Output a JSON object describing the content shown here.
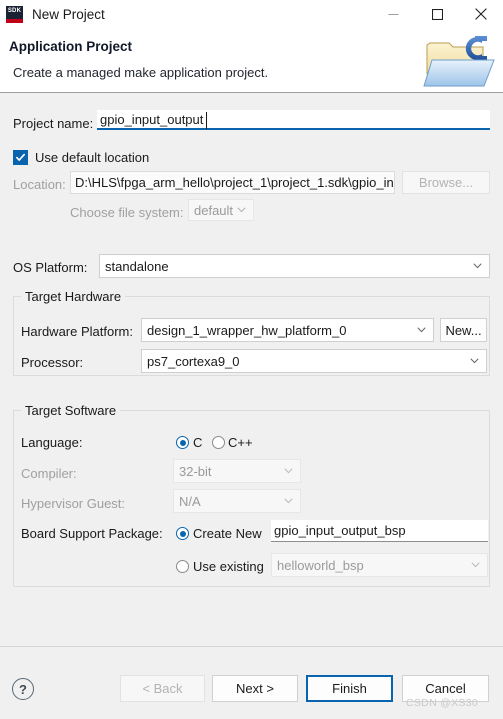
{
  "window": {
    "app_icon": "sdk-icon",
    "icon_text": "SDK",
    "title": "New Project",
    "controls": {
      "minimize": "minimize-icon",
      "maximize": "maximize-icon",
      "close": "close-icon"
    }
  },
  "header": {
    "title": "Application Project",
    "subtitle": "Create a managed make application project.",
    "art_icon": "c-project-folder-icon"
  },
  "form": {
    "project_name": {
      "label": "Project name:",
      "value": "gpio_input_output",
      "placeholder": ""
    },
    "use_default_location": {
      "label": "Use default location",
      "checked": true
    },
    "location": {
      "label": "Location:",
      "value": "D:\\HLS\\fpga_arm_hello\\project_1\\project_1.sdk\\gpio_in",
      "browse_label": "Browse...",
      "disabled": true
    },
    "file_system": {
      "label": "Choose file system:",
      "value": "default",
      "disabled": true
    },
    "os_platform": {
      "label": "OS Platform:",
      "value": "standalone"
    }
  },
  "target_hardware": {
    "group_title": "Target Hardware",
    "hardware_platform": {
      "label": "Hardware Platform:",
      "value": "design_1_wrapper_hw_platform_0",
      "new_label": "New..."
    },
    "processor": {
      "label": "Processor:",
      "value": "ps7_cortexa9_0"
    }
  },
  "target_software": {
    "group_title": "Target Software",
    "language": {
      "label": "Language:",
      "options": [
        "C",
        "C++"
      ],
      "selected": "C"
    },
    "compiler": {
      "label": "Compiler:",
      "value": "32-bit",
      "disabled": true
    },
    "hypervisor_guest": {
      "label": "Hypervisor Guest:",
      "value": "N/A",
      "disabled": true
    },
    "board_support_package": {
      "label": "Board Support Package:",
      "create_new_label": "Create New",
      "create_new_value": "gpio_input_output_bsp",
      "use_existing_label": "Use existing",
      "use_existing_value": "helloworld_bsp",
      "selected": "Create New"
    }
  },
  "footer": {
    "help": "?",
    "back": "< Back",
    "next": "Next >",
    "finish": "Finish",
    "cancel": "Cancel",
    "default_button": "Finish",
    "back_disabled": true
  },
  "watermark": "CSDN @XS30",
  "colors": {
    "accent": "#0a64ad",
    "window_bg": "#f0f0f0",
    "header_bg": "#ffffff",
    "sdk_icon_bg": "#1b2233",
    "sdk_icon_stripe": "#c00018",
    "disabled_text": "#a0a0a0"
  }
}
